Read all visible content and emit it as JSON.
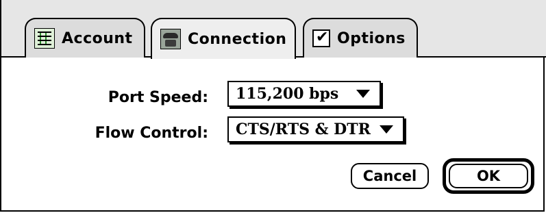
{
  "tabs": [
    {
      "label": "Account",
      "icon": "account-icon"
    },
    {
      "label": "Connection",
      "icon": "phone-icon",
      "active": true
    },
    {
      "label": "Options",
      "icon": "checkbox-icon"
    }
  ],
  "fields": {
    "port_speed": {
      "label": "Port Speed:",
      "value": "115,200  bps"
    },
    "flow_control": {
      "label": "Flow Control:",
      "value": "CTS/RTS & DTR"
    }
  },
  "buttons": {
    "cancel": "Cancel",
    "ok": "OK"
  }
}
